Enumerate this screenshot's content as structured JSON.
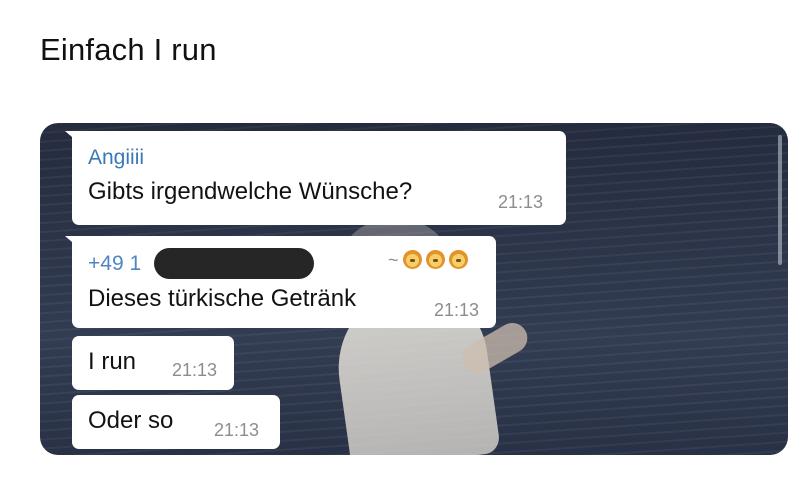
{
  "post": {
    "title": "Einfach I run"
  },
  "chat": {
    "messages": [
      {
        "sender": "Angiiii",
        "text": "Gibts irgendwelche Wünsche?",
        "time": "21:13"
      },
      {
        "sender": "+49 1",
        "sender_suffix": "~",
        "sender_emoji": [
          "lion-face-icon",
          "lion-face-icon",
          "lion-face-icon"
        ],
        "text": "Dieses türkische Getränk",
        "time": "21:13"
      },
      {
        "text": "I run",
        "time": "21:13"
      },
      {
        "text": "Oder so",
        "time": "21:13"
      }
    ]
  },
  "colors": {
    "sender_name_1": "#3a79b6",
    "sender_name_2": "#4f86c2",
    "timestamp": "#8d8d8d",
    "bubble": "#ffffff",
    "redaction": "#262626",
    "chat_background": "#2b3448"
  }
}
